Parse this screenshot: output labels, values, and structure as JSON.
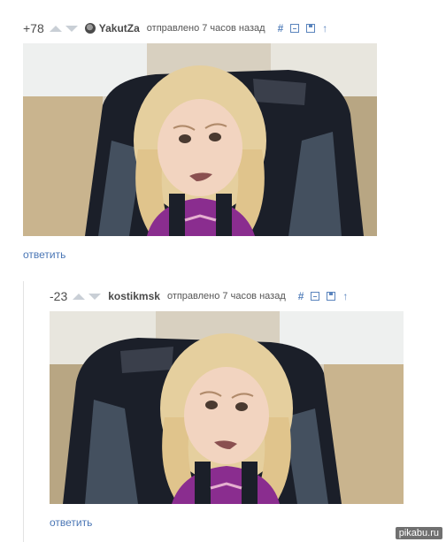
{
  "comments": [
    {
      "rating": "+78",
      "username": "YakutZa",
      "meta": "отправлено 7 часов назад",
      "actions": {
        "hash": "#",
        "collapse": "minus-box-icon",
        "save": "save-icon",
        "parent": "↑"
      },
      "reply": "ответить"
    },
    {
      "rating": "-23",
      "username": "kostikmsk",
      "meta": "отправлено 7 часов назад",
      "actions": {
        "hash": "#",
        "collapse": "minus-box-icon",
        "save": "save-icon",
        "parent": "↑"
      },
      "reply": "ответить"
    }
  ],
  "watermark": "pikabu.ru",
  "colors": {
    "link": "#4a76b5",
    "vote_arrow": "#c9cfd6",
    "seat": "#1b1f29",
    "shirt": "#8a2d8f",
    "hair": "#e5cf9e"
  }
}
